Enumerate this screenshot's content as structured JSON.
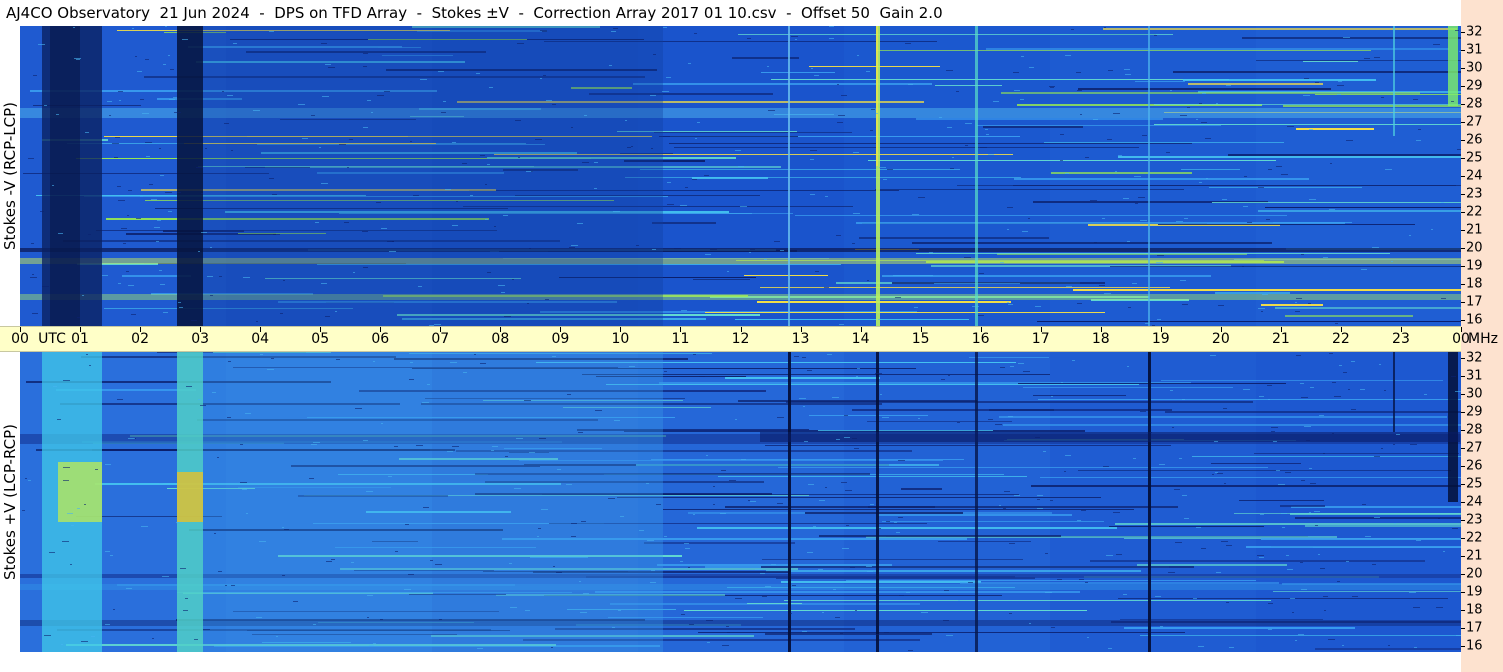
{
  "title": "AJ4CO Observatory  21 Jun 2024  -  DPS on TFD Array  -  Stokes ±V  -  Correction Array 2017 01 10.csv  -  Offset 50  Gain 2.0",
  "panels": {
    "top_label": "Stokes -V (RCP-LCP)",
    "bottom_label": "Stokes +V (LCP-RCP)"
  },
  "time_axis": {
    "labels": [
      "00",
      "01",
      "02",
      "03",
      "04",
      "05",
      "06",
      "07",
      "08",
      "09",
      "10",
      "11",
      "12",
      "13",
      "14",
      "15",
      "16",
      "17",
      "18",
      "19",
      "20",
      "21",
      "22",
      "23",
      "00"
    ],
    "unit": "UTC",
    "end_unit": "MHz"
  },
  "freq_axis": {
    "labels": [
      "32",
      "31",
      "30",
      "29",
      "28",
      "27",
      "26",
      "25",
      "24",
      "23",
      "22",
      "21",
      "20",
      "19",
      "18",
      "17",
      "16"
    ]
  },
  "colors": {
    "background_blue": "#1e5ad2",
    "axis_band": "#ffffc8",
    "right_strip": "#fde2cf"
  }
}
